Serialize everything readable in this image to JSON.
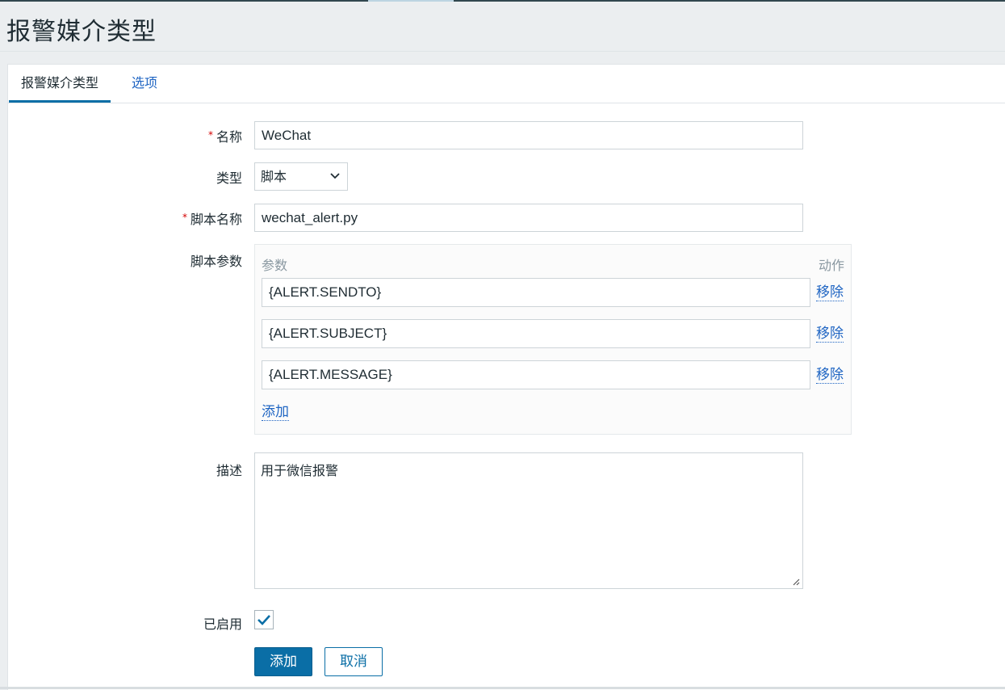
{
  "page": {
    "title": "报警媒介类型"
  },
  "tabs": [
    {
      "label": "报警媒介类型",
      "active": true
    },
    {
      "label": "选项",
      "active": false
    }
  ],
  "form": {
    "name_label": "名称",
    "name_value": "WeChat",
    "type_label": "类型",
    "type_value": "脚本",
    "script_name_label": "脚本名称",
    "script_name_value": "wechat_alert.py",
    "params_label": "脚本参数",
    "params_header": "参数",
    "actions_header": "动作",
    "params": [
      {
        "value": "{ALERT.SENDTO}",
        "remove_label": "移除"
      },
      {
        "value": "{ALERT.SUBJECT}",
        "remove_label": "移除"
      },
      {
        "value": "{ALERT.MESSAGE}",
        "remove_label": "移除"
      }
    ],
    "add_param_label": "添加",
    "description_label": "描述",
    "description_value": "用于微信报警",
    "enabled_label": "已启用",
    "enabled": true
  },
  "buttons": {
    "add": "添加",
    "cancel": "取消"
  },
  "colors": {
    "accent": "#0a6ea6",
    "link": "#1f65c3",
    "required": "#d40000"
  },
  "icons": {
    "select": "chevron-down-icon",
    "check": "checkmark-icon",
    "resize": "resize-grip-icon"
  }
}
